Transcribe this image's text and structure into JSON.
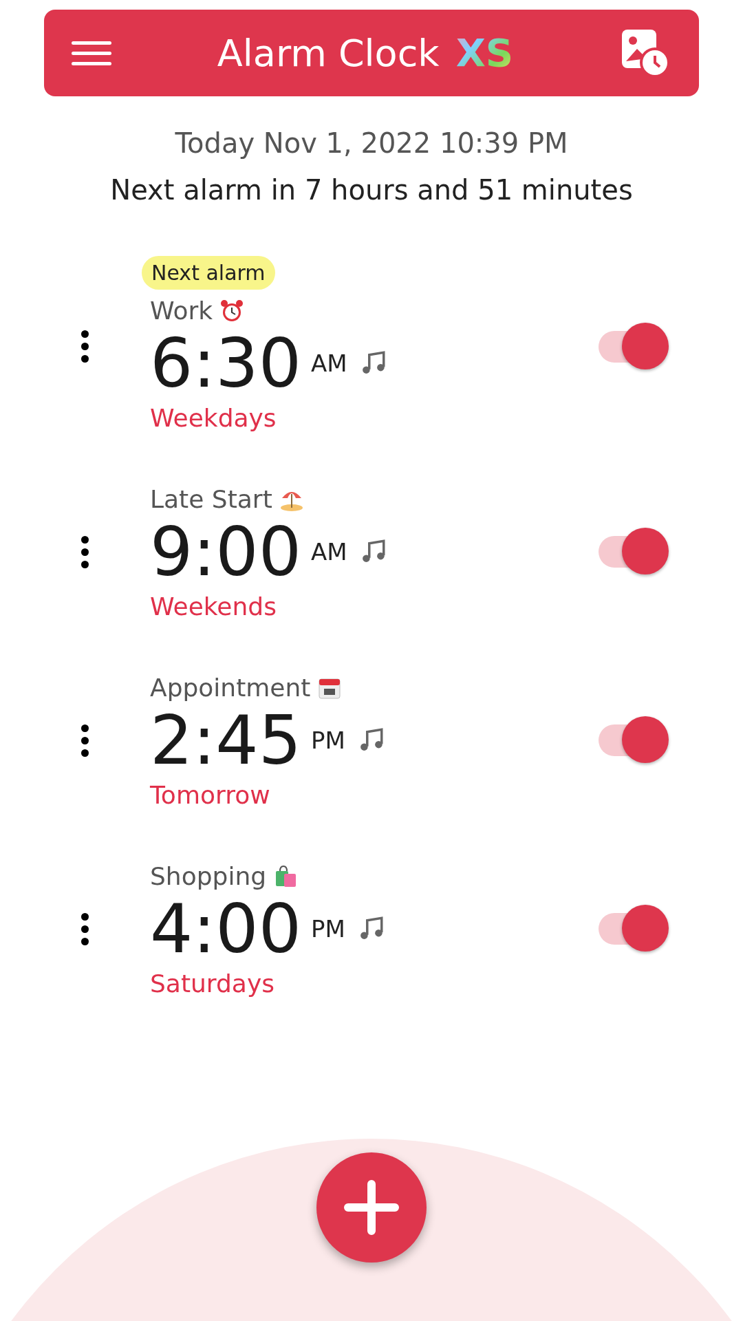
{
  "header": {
    "title": "Alarm Clock",
    "logo": "XS"
  },
  "date": "Today Nov 1, 2022 10:39 PM",
  "next_alarm": "Next alarm in 7 hours and 51 minutes",
  "alarms": [
    {
      "badge": "Next alarm",
      "label": "Work",
      "time": "6:30",
      "period": "AM",
      "repeat": "Weekdays",
      "on": true
    },
    {
      "label": "Late Start",
      "time": "9:00",
      "period": "AM",
      "repeat": "Weekends",
      "on": true
    },
    {
      "label": "Appointment",
      "time": "2:45",
      "period": "PM",
      "repeat": "Tomorrow",
      "on": true
    },
    {
      "label": "Shopping",
      "time": "4:00",
      "period": "PM",
      "repeat": "Saturdays",
      "on": true
    }
  ]
}
